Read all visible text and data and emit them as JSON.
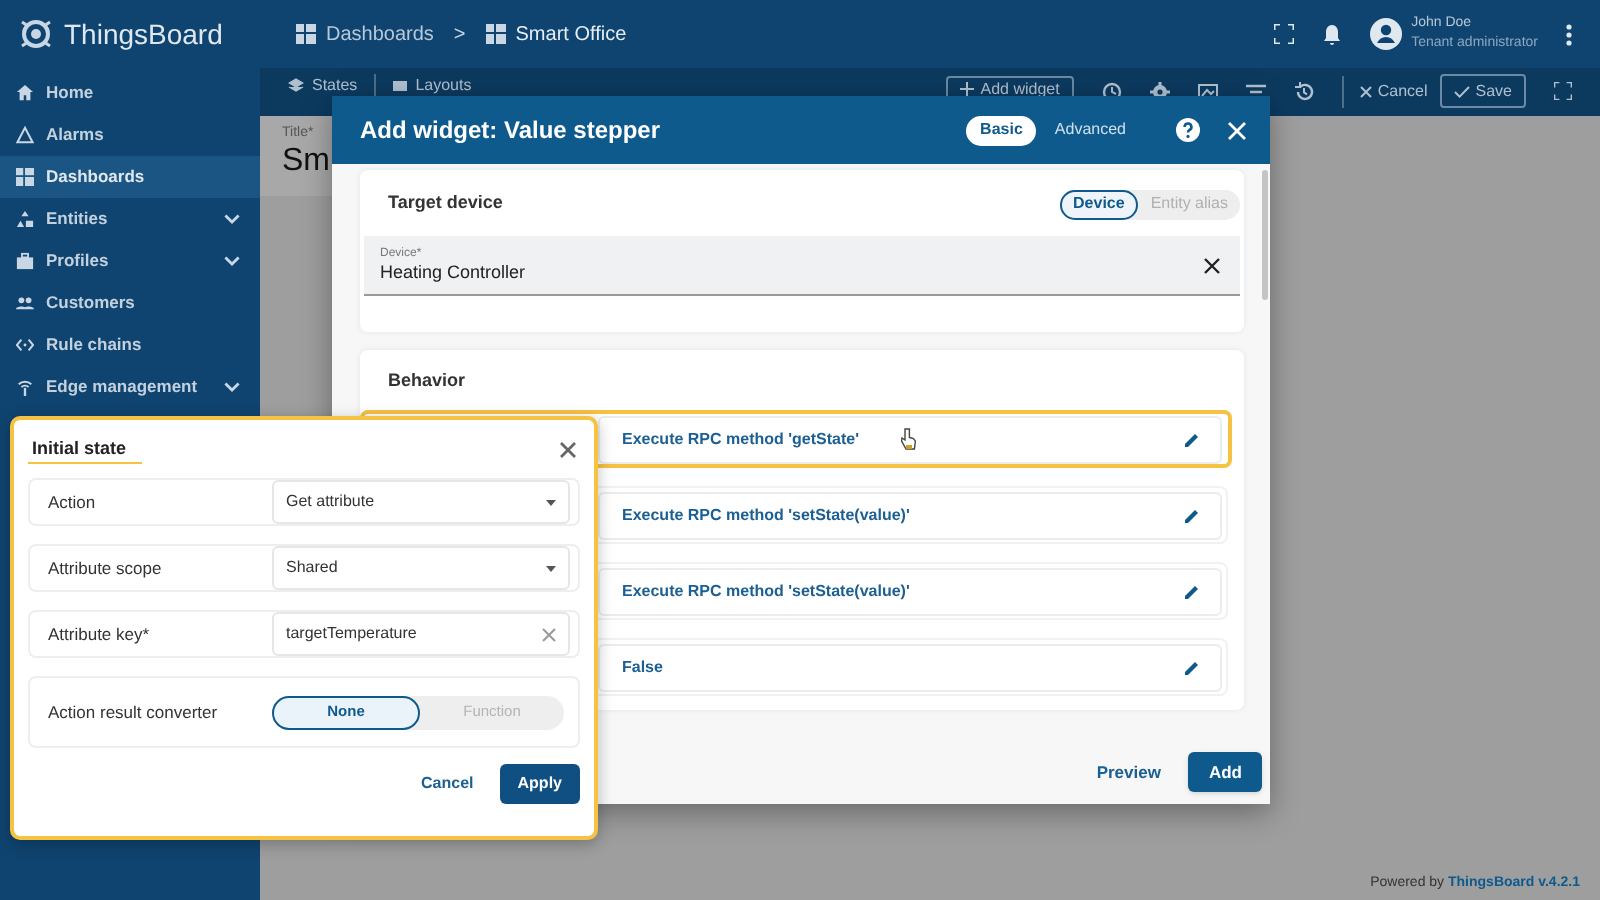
{
  "app": {
    "logo": "ThingsBoard"
  },
  "breadcrumb": {
    "items": [
      {
        "label": "Dashboards"
      },
      {
        "label": "Smart Office"
      }
    ],
    "separator": ">"
  },
  "user": {
    "name": "John Doe",
    "role": "Tenant administrator"
  },
  "sidebar": {
    "items": [
      {
        "label": "Home",
        "selected": false,
        "expandable": false
      },
      {
        "label": "Alarms",
        "selected": false,
        "expandable": false
      },
      {
        "label": "Dashboards",
        "selected": true,
        "expandable": false
      },
      {
        "label": "Entities",
        "selected": false,
        "expandable": true
      },
      {
        "label": "Profiles",
        "selected": false,
        "expandable": true
      },
      {
        "label": "Customers",
        "selected": false,
        "expandable": false
      },
      {
        "label": "Rule chains",
        "selected": false,
        "expandable": false
      },
      {
        "label": "Edge management",
        "selected": false,
        "expandable": true
      }
    ]
  },
  "toolbar": {
    "tabs": [
      {
        "label": "States"
      },
      {
        "label": "Layouts"
      }
    ],
    "add_widget": "Add widget",
    "cancel": "Cancel",
    "save": "Save"
  },
  "dashboard": {
    "title_label": "Title*",
    "title": "Sm"
  },
  "dialog": {
    "title": "Add widget: Value stepper",
    "modes": [
      {
        "label": "Basic",
        "selected": true
      },
      {
        "label": "Advanced",
        "selected": false
      }
    ],
    "target_device": {
      "heading": "Target device",
      "options": [
        {
          "label": "Device",
          "selected": true
        },
        {
          "label": "Entity alias",
          "selected": false
        }
      ],
      "field": {
        "label": "Device*",
        "value": "Heating Controller"
      }
    },
    "behavior": {
      "heading": "Behavior",
      "rows": [
        {
          "value": "Execute RPC method 'getState'",
          "highlighted": true
        },
        {
          "value": "Execute RPC method 'setState(value)'",
          "highlighted": false
        },
        {
          "value": "Execute RPC method 'setState(value)'",
          "highlighted": false
        },
        {
          "value": "False",
          "highlighted": false
        }
      ]
    },
    "preview": "Preview",
    "add": "Add"
  },
  "popover": {
    "title": "Initial state",
    "fields": [
      {
        "kind": "select",
        "label": "Action",
        "value": "Get attribute"
      },
      {
        "kind": "select",
        "label": "Attribute scope",
        "value": "Shared"
      },
      {
        "kind": "text",
        "label": "Attribute key*",
        "value": "targetTemperature"
      },
      {
        "kind": "toggle",
        "label": "Action result converter",
        "options": [
          {
            "label": "None",
            "selected": true
          },
          {
            "label": "Function",
            "selected": false
          }
        ]
      }
    ],
    "cancel": "Cancel",
    "apply": "Apply"
  },
  "footer": {
    "prefix": "Powered by",
    "brand": "ThingsBoard v.4.2.1"
  }
}
